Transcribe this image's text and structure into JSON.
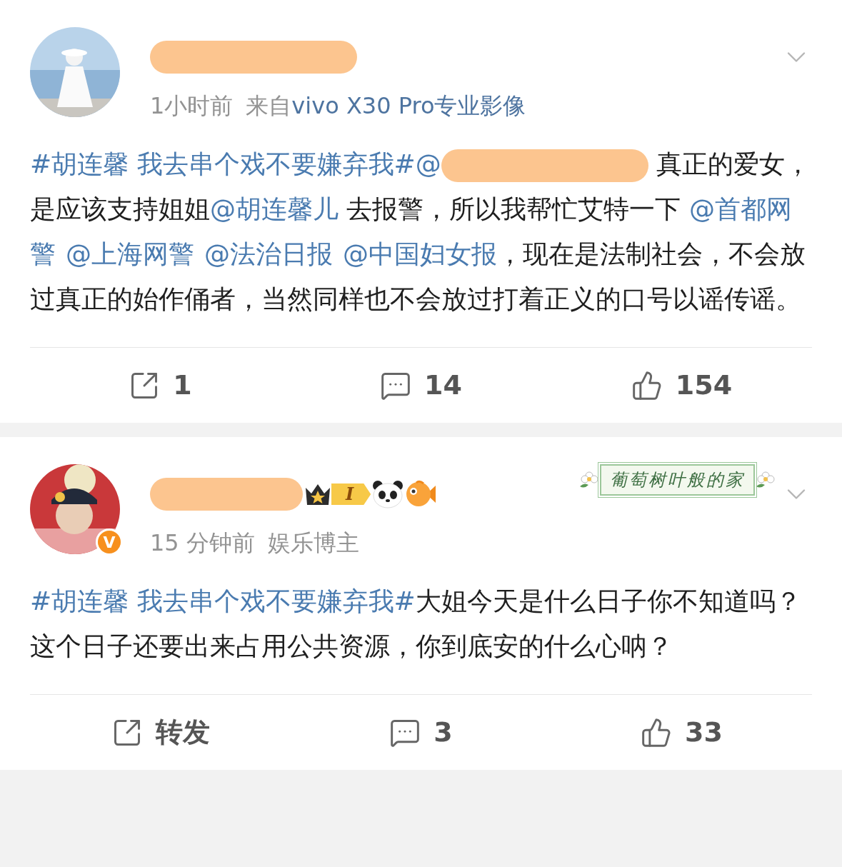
{
  "posts": [
    {
      "author": {
        "name_redacted": true
      },
      "time": "1小时前",
      "source_prefix": "来自",
      "source": "vivo X30 Pro专业影像",
      "body": [
        {
          "kind": "topic",
          "text": "#胡连馨 我去串个戏不要嫌弃我#"
        },
        {
          "kind": "mention",
          "text": "@"
        },
        {
          "kind": "redacted"
        },
        {
          "kind": "text",
          "text": " 真正的爱女，是应该支持姐姐"
        },
        {
          "kind": "mention",
          "text": "@胡连馨儿"
        },
        {
          "kind": "text",
          "text": " 去报警，所以我帮忙艾特一下 "
        },
        {
          "kind": "mention",
          "text": "@首都网警"
        },
        {
          "kind": "mention",
          "text": "@上海网警"
        },
        {
          "kind": "mention",
          "text": "@法治日报"
        },
        {
          "kind": "mention",
          "text": "@中国妇女报"
        },
        {
          "kind": "text",
          "text": "，现在是法制社会，不会放过真正的始作俑者，当然同样也不会放过打着正义的口号以谣传谣。"
        }
      ],
      "actions": [
        {
          "kind": "repost",
          "label": "1"
        },
        {
          "kind": "comment",
          "label": "14"
        },
        {
          "kind": "like",
          "label": "154"
        }
      ]
    },
    {
      "author": {
        "name_redacted": true,
        "verified_badge": "V",
        "badges": [
          {
            "kind": "level",
            "label": "I"
          },
          {
            "kind": "panda"
          },
          {
            "kind": "fish"
          }
        ],
        "nameplate": "葡萄树叶般的家"
      },
      "time": "15 分钟前",
      "role": "娱乐博主",
      "body": [
        {
          "kind": "topic",
          "text": "#胡连馨 我去串个戏不要嫌弃我#"
        },
        {
          "kind": "text",
          "text": "大姐今天是什么日子你不知道吗？这个日子还要出来占用公共资源，你到底安的什么心呐？"
        }
      ],
      "actions": [
        {
          "kind": "repost",
          "label": "转发"
        },
        {
          "kind": "comment",
          "label": "3"
        },
        {
          "kind": "like",
          "label": "33"
        }
      ]
    }
  ]
}
